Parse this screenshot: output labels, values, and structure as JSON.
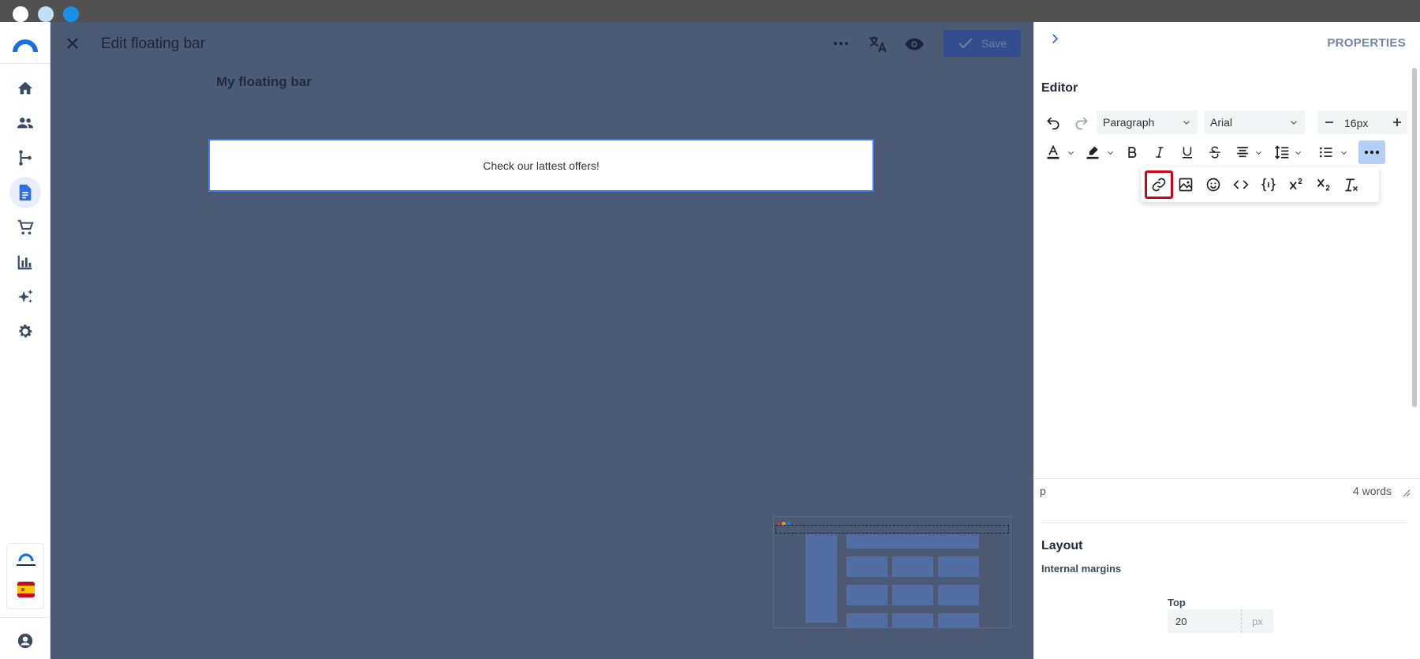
{
  "window": {
    "dots": [
      "#ffffff",
      "#bfe0f7",
      "#1a8fe8"
    ]
  },
  "rail": {
    "items": [
      {
        "name": "home-icon"
      },
      {
        "name": "users-icon"
      },
      {
        "name": "flow-icon"
      },
      {
        "name": "document-icon",
        "active": true
      },
      {
        "name": "cart-icon"
      },
      {
        "name": "chart-icon"
      },
      {
        "name": "sparkle-icon"
      },
      {
        "name": "gear-icon"
      }
    ],
    "brand_label": "CONNECTIF"
  },
  "header": {
    "title": "Edit floating bar",
    "save_label": "Save"
  },
  "canvas": {
    "bar_name": "My floating bar",
    "bar_text": "Check our lattest offers!"
  },
  "panel": {
    "title": "PROPERTIES",
    "editor_title": "Editor",
    "block_format": "Paragraph",
    "font_family": "Arial",
    "font_size": "16px",
    "status_element": "p",
    "word_count": "4 words",
    "layout_title": "Layout",
    "internal_margins_label": "Internal margins",
    "top_label": "Top",
    "top_value": "20",
    "top_unit": "px"
  },
  "colors": {
    "accent": "#3d7be5",
    "highlight": "#d0021b",
    "overlay": "#4d5a73"
  }
}
